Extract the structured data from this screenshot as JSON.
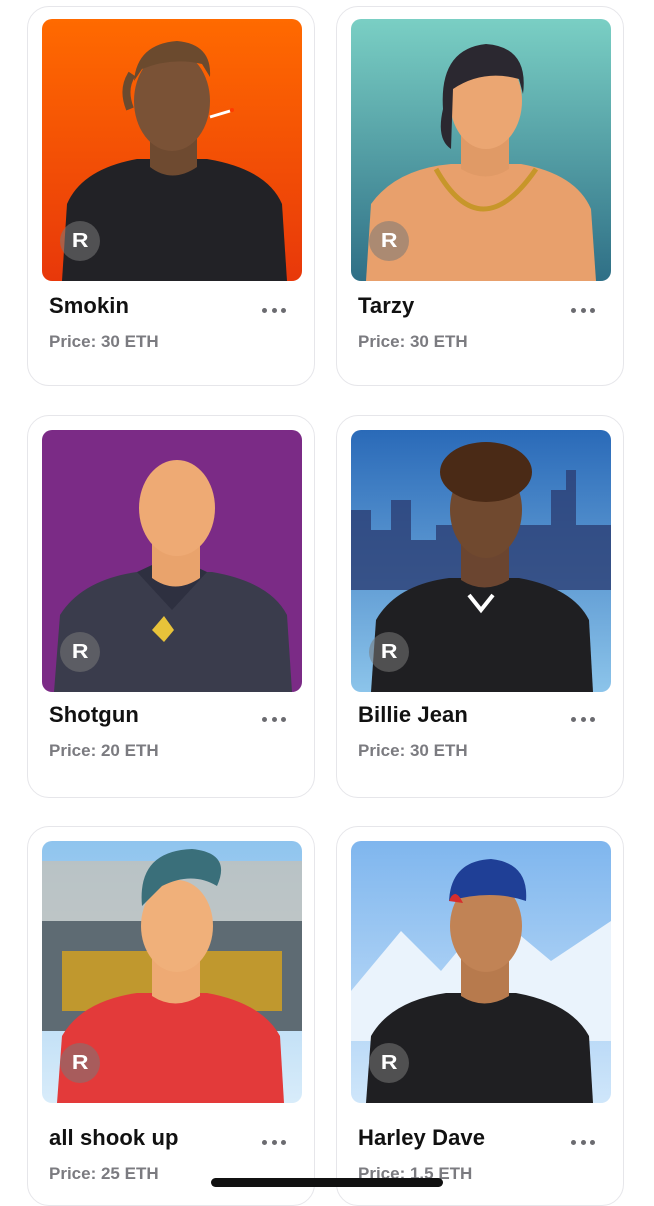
{
  "nfts": [
    {
      "name": "Smokin",
      "price": "Price: 30 ETH"
    },
    {
      "name": "Tarzy",
      "price": "Price: 30 ETH"
    },
    {
      "name": "Shotgun",
      "price": "Price: 20 ETH"
    },
    {
      "name": "Billie Jean",
      "price": "Price: 30 ETH"
    },
    {
      "name": "all shook up",
      "price": "Price: 25 ETH"
    },
    {
      "name": "Harley Dave",
      "price": "Price: 1.5 ETH"
    }
  ],
  "badge_letter": "R",
  "icons": {
    "more": "more-horizontal-icon",
    "badge": "rarible-badge-icon"
  },
  "colors": {
    "orange": "#ff6a00",
    "teal": "#66c3bd",
    "purple": "#7b2b86",
    "skin": "#7a5236"
  }
}
